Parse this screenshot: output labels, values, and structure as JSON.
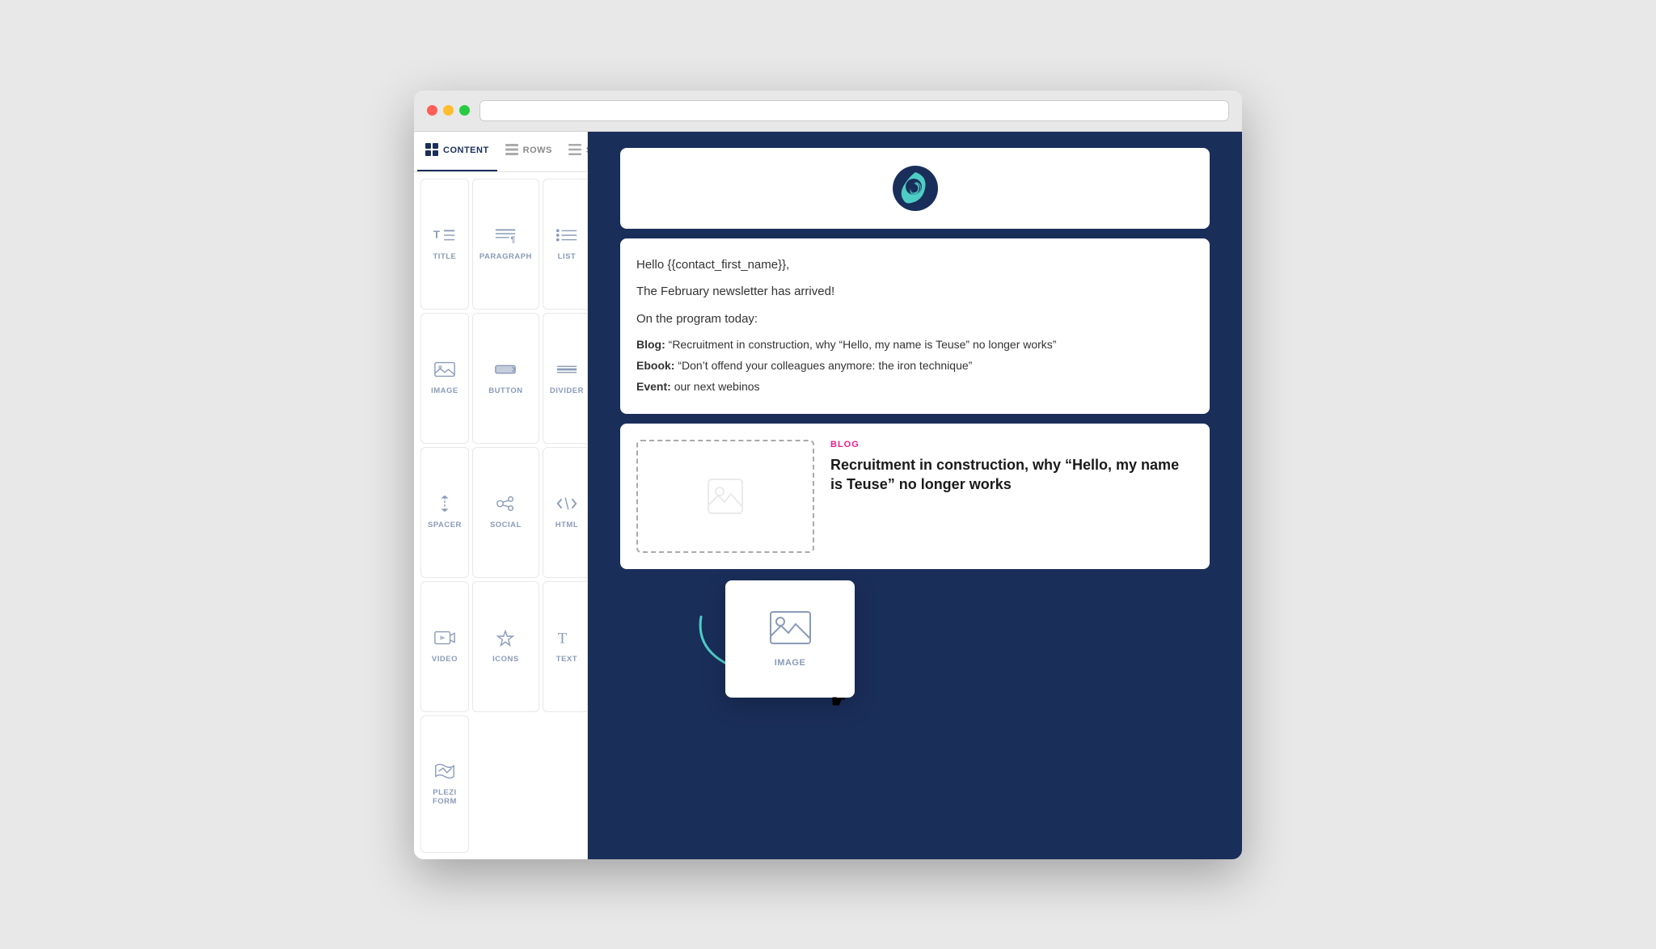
{
  "browser": {
    "url": ""
  },
  "sidebar": {
    "tabs": [
      {
        "id": "content",
        "label": "CONTENT",
        "active": true
      },
      {
        "id": "rows",
        "label": "ROWS",
        "active": false
      },
      {
        "id": "settings",
        "label": "SETTINGS",
        "active": false
      }
    ],
    "items": [
      {
        "id": "title",
        "label": "TITLE"
      },
      {
        "id": "paragraph",
        "label": "PARAGRAPH"
      },
      {
        "id": "list",
        "label": "LIST"
      },
      {
        "id": "image",
        "label": "IMAGE"
      },
      {
        "id": "button",
        "label": "BUTTON"
      },
      {
        "id": "divider",
        "label": "DIVIDER"
      },
      {
        "id": "spacer",
        "label": "SPACER"
      },
      {
        "id": "social",
        "label": "SOCIAL"
      },
      {
        "id": "html",
        "label": "HTML"
      },
      {
        "id": "video",
        "label": "VIDEO"
      },
      {
        "id": "icons",
        "label": "ICONS"
      },
      {
        "id": "text",
        "label": "TEXT"
      },
      {
        "id": "plezi-form",
        "label": "PLEZI FORM"
      }
    ]
  },
  "email": {
    "greeting": "Hello {{contact_first_name}},",
    "intro": "The February newsletter has arrived!",
    "program_title": "On the program today:",
    "blog_label": "Blog:",
    "blog_text": "“Recruitment in construction, why “Hello, my name is Teuse” no longer works”",
    "ebook_label": "Ebook:",
    "ebook_text": "“Don’t offend your colleagues anymore: the iron technique”",
    "event_label": "Event:",
    "event_text": "our next webinos",
    "blog_card": {
      "tag": "BLOG",
      "title": "Recruitment in construction, why “Hello, my name is Teuse” no longer works"
    }
  },
  "drag_item": {
    "label": "IMAGE"
  }
}
